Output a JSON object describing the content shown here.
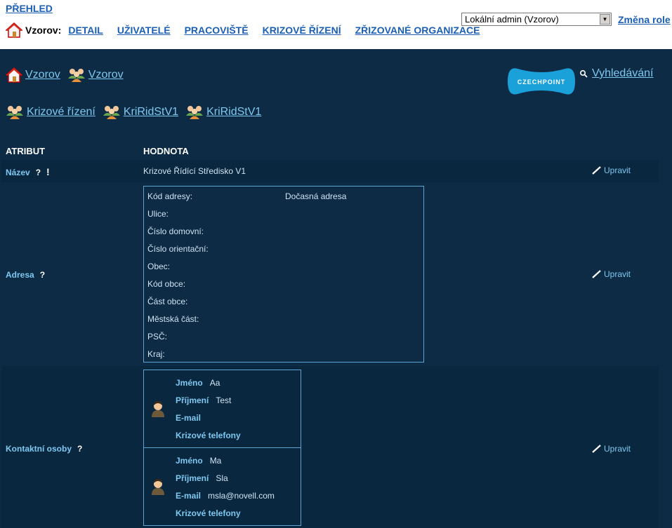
{
  "topbar": {
    "overview_label": "PŘEHLED",
    "org_name": "Vzorov:",
    "nav": [
      "DETAIL",
      "UŽIVATELÉ",
      "PRACOVIŠTĚ",
      "KRIZOVÉ ŘÍZENÍ",
      "ZŘIZOVANÉ ORGANIZACE"
    ],
    "role_select_value": "Lokální admin (Vzorov)",
    "role_change_label": "Změna role"
  },
  "breadcrumbs": {
    "line1": [
      "Vzorov",
      "Vzorov"
    ],
    "line2": [
      "Krizové řízení",
      "KriRidStV1",
      "KriRidStV1"
    ]
  },
  "czechpoint_logo": "CZECHPOINT",
  "search_label": "Vyhledávání",
  "table": {
    "col_attr": "ATRIBUT",
    "col_value": "HODNOTA",
    "edit_label": "Upravit",
    "help_mark": "?",
    "required_mark": "!",
    "name_row": {
      "label": "Název",
      "value": "Krizové Řídící Středisko V1"
    },
    "address_row": {
      "label": "Adresa",
      "fields": [
        {
          "label": "Kód adresy:",
          "value": "Dočasná adresa"
        },
        {
          "label": "Ulice:",
          "value": ""
        },
        {
          "label": "Číslo domovní:",
          "value": ""
        },
        {
          "label": "Číslo orientační:",
          "value": ""
        },
        {
          "label": "Obec:",
          "value": ""
        },
        {
          "label": "Kód obce:",
          "value": ""
        },
        {
          "label": "Část obce:",
          "value": ""
        },
        {
          "label": "Městská část:",
          "value": ""
        },
        {
          "label": "PSČ:",
          "value": ""
        },
        {
          "label": "Kraj:",
          "value": ""
        }
      ]
    },
    "contacts_row": {
      "label": "Kontaktní osoby",
      "contacts": [
        {
          "first_label": "Jméno",
          "first": "Aa",
          "last_label": "Příjmení",
          "last": "Test",
          "email_label": "E-mail",
          "email": "",
          "phones_label": "Krizové telefony"
        },
        {
          "first_label": "Jméno",
          "first": "Ma",
          "last_label": "Příjmení",
          "last": "Sla",
          "email_label": "E-mail",
          "email": "msla@novell.com",
          "phones_label": "Krizové telefony"
        }
      ]
    }
  },
  "colors": {
    "background": "#0d2b45",
    "link": "#7ec8f0",
    "top_link": "#1a5fb4",
    "logo": "#1ba1d9"
  },
  "icons": [
    "home-icon",
    "group-icon",
    "search-icon",
    "pencil-icon",
    "user-avatar-icon",
    "select-arrow-icon"
  ]
}
